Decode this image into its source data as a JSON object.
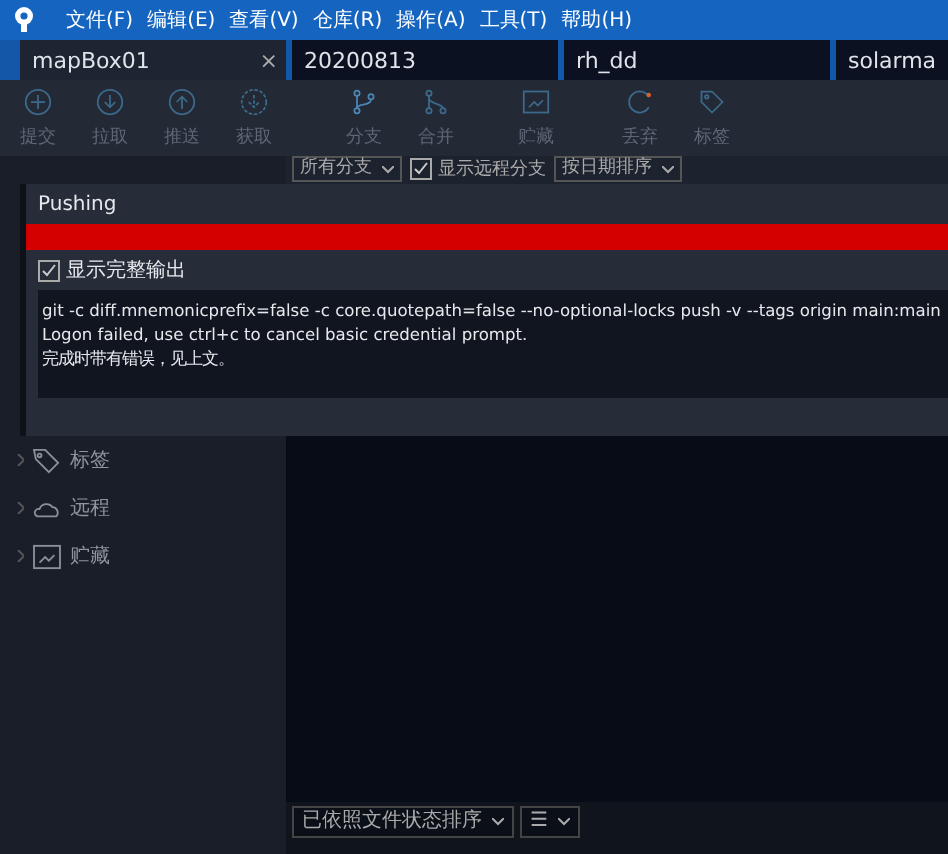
{
  "menu": [
    "文件(F)",
    "编辑(E)",
    "查看(V)",
    "仓库(R)",
    "操作(A)",
    "工具(T)",
    "帮助(H)"
  ],
  "tabs": [
    {
      "label": "mapBox01",
      "selected": true,
      "close": "×"
    },
    {
      "label": "20200813",
      "selected": false
    },
    {
      "label": "rh_dd",
      "selected": false
    },
    {
      "label": "solarma",
      "selected": false
    }
  ],
  "toolbar": [
    {
      "label": "提交",
      "kind": "commit"
    },
    {
      "label": "拉取",
      "kind": "pull"
    },
    {
      "label": "推送",
      "kind": "push"
    },
    {
      "label": "获取",
      "kind": "fetch"
    },
    {
      "label": "分支",
      "kind": "branch"
    },
    {
      "label": "合并",
      "kind": "merge"
    },
    {
      "label": "贮藏",
      "kind": "stash"
    },
    {
      "label": "丢弃",
      "kind": "discard"
    },
    {
      "label": "标签",
      "kind": "tag"
    }
  ],
  "filters": {
    "branches": "所有分支",
    "show_remote": {
      "label": "显示远程分支",
      "checked": true
    },
    "sort": "按日期排序"
  },
  "dialog": {
    "title": "Pushing",
    "progress": {
      "level": 1,
      "failed": true
    },
    "show_full_output": {
      "label": "显示完整输出",
      "checked": true
    },
    "output": [
      "git -c diff.mnemonicprefix=false -c core.quotepath=false --no-optional-locks push -v --tags origin main:main",
      "Logon failed, use ctrl+c to cancel basic credential prompt.",
      "完成时带有错误，见上文。"
    ]
  },
  "sidebar": [
    {
      "label": "标签",
      "kind": "tag",
      "expanded": false
    },
    {
      "label": "远程",
      "kind": "cloud",
      "expanded": false
    },
    {
      "label": "贮藏",
      "kind": "stash",
      "expanded": false
    }
  ],
  "bottom": {
    "sort": "已依照文件状态排序",
    "view": "☰"
  }
}
